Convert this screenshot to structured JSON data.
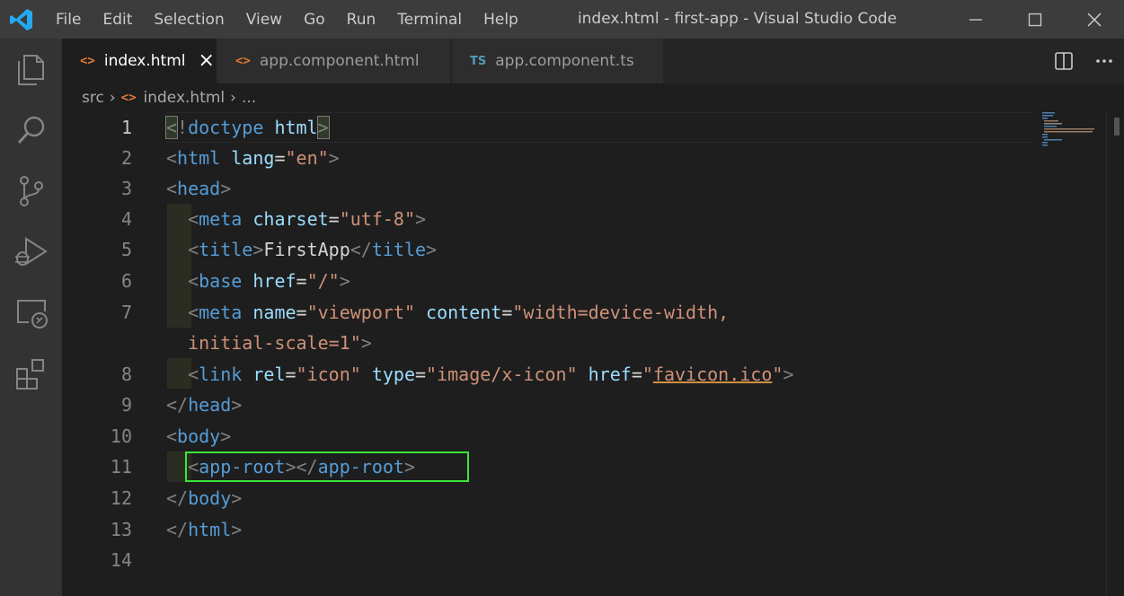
{
  "titlebar": {
    "menu": [
      "File",
      "Edit",
      "Selection",
      "View",
      "Go",
      "Run",
      "Terminal",
      "Help"
    ],
    "window_title": "index.html - first-app - Visual Studio Code"
  },
  "activity_bar": [
    "explorer-icon",
    "search-icon",
    "source-control-icon",
    "run-debug-icon",
    "remote-explorer-icon",
    "extensions-icon"
  ],
  "tabs": [
    {
      "icon": "<>",
      "label": "index.html",
      "active": true
    },
    {
      "icon": "<>",
      "label": "app.component.html",
      "active": false
    },
    {
      "icon": "TS",
      "label": "app.component.ts",
      "active": false
    }
  ],
  "breadcrumb": {
    "folder": "src",
    "file_icon": "<>",
    "file": "index.html",
    "more": "..."
  },
  "line_numbers": [
    "1",
    "2",
    "3",
    "4",
    "5",
    "6",
    "7",
    "8",
    "9",
    "10",
    "11",
    "12",
    "13",
    "14"
  ],
  "code": {
    "l1": {
      "open": "<",
      "bang": "!",
      "doctype": "doctype",
      "html": "html",
      "close": ">"
    },
    "l2": {
      "lt": "<",
      "tag": "html",
      "attr": "lang",
      "eq": "=",
      "val": "\"en\"",
      "gt": ">"
    },
    "l3": {
      "lt": "<",
      "tag": "head",
      "gt": ">"
    },
    "l4": {
      "lt": "<",
      "tag": "meta",
      "attr": "charset",
      "eq": "=",
      "val": "\"utf-8\"",
      "gt": ">"
    },
    "l5": {
      "lt": "<",
      "tag": "title",
      "gt": ">",
      "text": "FirstApp",
      "clt": "</",
      "ctag": "title",
      "cgt": ">"
    },
    "l6": {
      "lt": "<",
      "tag": "base",
      "attr": "href",
      "eq": "=",
      "val": "\"/\"",
      "gt": ">"
    },
    "l7": {
      "lt": "<",
      "tag": "meta",
      "attr1": "name",
      "eq1": "=",
      "val1": "\"viewport\"",
      "attr2": "content",
      "eq2": "=",
      "val2": "\"width=device-width,"
    },
    "l7b": {
      "val": "initial-scale=1\"",
      "gt": ">"
    },
    "l8": {
      "lt": "<",
      "tag": "link",
      "attr1": "rel",
      "eq1": "=",
      "val1": "\"icon\"",
      "attr2": "type",
      "eq2": "=",
      "val2": "\"image/x-icon\"",
      "attr3": "href",
      "eq3": "=",
      "q1": "\"",
      "val3": "favicon.ico",
      "q2": "\"",
      "gt": ">"
    },
    "l9": {
      "lt": "</",
      "tag": "head",
      "gt": ">"
    },
    "l10": {
      "lt": "<",
      "tag": "body",
      "gt": ">"
    },
    "l11": {
      "lt": "<",
      "tag": "app-root",
      "gt": ">",
      "clt": "</",
      "ctag": "app-root",
      "cgt": ">"
    },
    "l12": {
      "lt": "</",
      "tag": "body",
      "gt": ">"
    },
    "l13": {
      "lt": "</",
      "tag": "html",
      "gt": ">"
    }
  },
  "colors": {
    "highlight_box": "#39e63a",
    "tag": "#569cd6",
    "attribute": "#9cdcfe",
    "string": "#ce9178"
  }
}
